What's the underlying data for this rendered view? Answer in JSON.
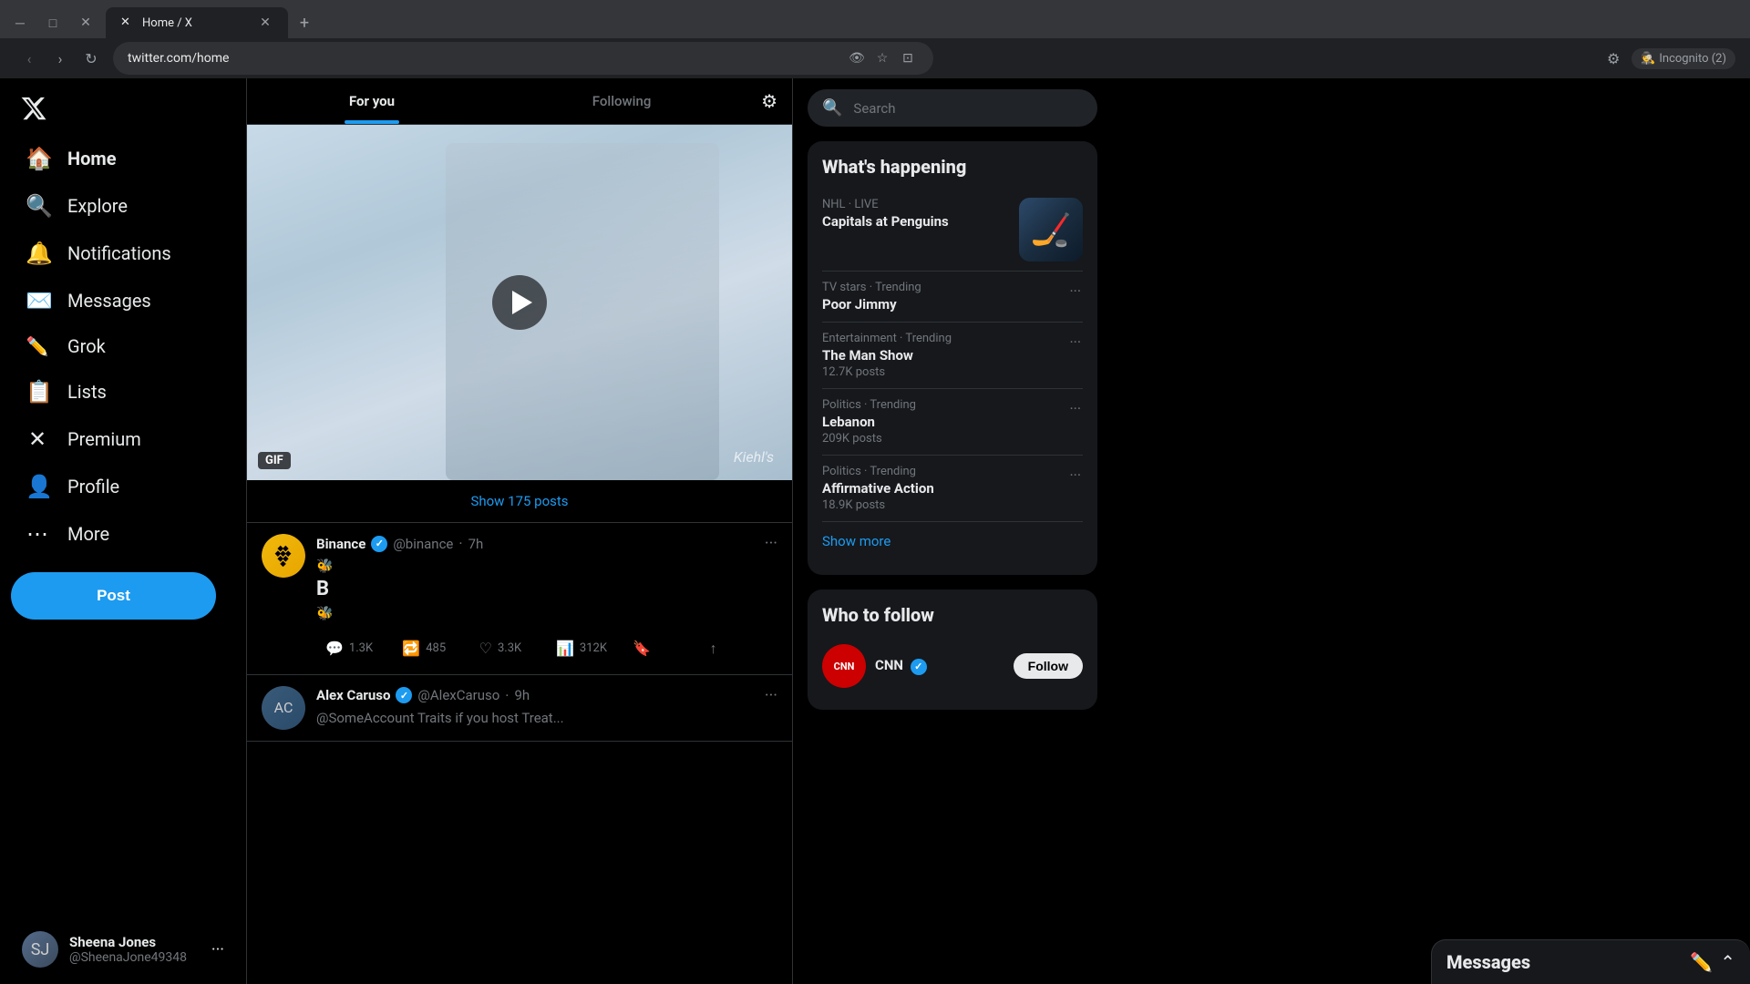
{
  "browser": {
    "tab_title": "Home / X",
    "url": "twitter.com/home",
    "incognito_label": "Incognito (2)"
  },
  "sidebar": {
    "logo_label": "X",
    "nav_items": [
      {
        "id": "home",
        "label": "Home",
        "icon": "🏠",
        "active": true
      },
      {
        "id": "explore",
        "label": "Explore",
        "icon": "🔍"
      },
      {
        "id": "notifications",
        "label": "Notifications",
        "icon": "🔔"
      },
      {
        "id": "messages",
        "label": "Messages",
        "icon": "✉️"
      },
      {
        "id": "grok",
        "label": "Grok",
        "icon": "✏️"
      },
      {
        "id": "lists",
        "label": "Lists",
        "icon": "📋"
      },
      {
        "id": "premium",
        "label": "Premium",
        "icon": "✕"
      },
      {
        "id": "profile",
        "label": "Profile",
        "icon": "👤"
      },
      {
        "id": "more",
        "label": "More",
        "icon": "⋯"
      }
    ],
    "post_button": "Post",
    "user": {
      "name": "Sheena Jones",
      "handle": "@SheenaJone49348"
    }
  },
  "feed": {
    "tab_for_you": "For you",
    "tab_following": "Following",
    "show_posts_text": "Show 175 posts",
    "gif_badge": "GIF",
    "watermark": "Kiehl's",
    "tweet1": {
      "name": "Binance",
      "handle": "@binance",
      "time": "7h",
      "verified": true,
      "text_line1": "🐝",
      "text_line2": "B",
      "text_line3": "🐝",
      "replies": "1.3K",
      "retweets": "485",
      "likes": "3.3K",
      "views": "312K"
    },
    "tweet2": {
      "name": "Alex Caruso",
      "handle": "@AlexCaruso",
      "time": "9h",
      "verified": true,
      "partial_text": "@SomeAccount Traits if you host Treat..."
    }
  },
  "right_panel": {
    "search_placeholder": "Search",
    "whats_happening_title": "What's happening",
    "trending_items": [
      {
        "id": "nhl",
        "category": "NHL · LIVE",
        "topic": "Capitals at Penguins",
        "has_image": true
      },
      {
        "id": "tv-stars",
        "category": "TV stars · Trending",
        "topic": "Poor Jimmy",
        "count": null
      },
      {
        "id": "entertainment",
        "category": "Entertainment · Trending",
        "topic": "The Man Show",
        "count": "12.7K posts"
      },
      {
        "id": "politics-lebanon",
        "category": "Politics · Trending",
        "topic": "Lebanon",
        "count": "209K posts"
      },
      {
        "id": "politics-affirmative",
        "category": "Politics · Trending",
        "topic": "Affirmative Action",
        "count": "18.9K posts"
      }
    ],
    "show_more": "Show more",
    "who_to_follow_title": "Who to follow",
    "follow_items": [
      {
        "id": "cnn",
        "name": "CNN",
        "verified": true,
        "avatar_text": "CNN",
        "avatar_color": "#cc0000"
      }
    ],
    "messages_label": "Messages"
  }
}
